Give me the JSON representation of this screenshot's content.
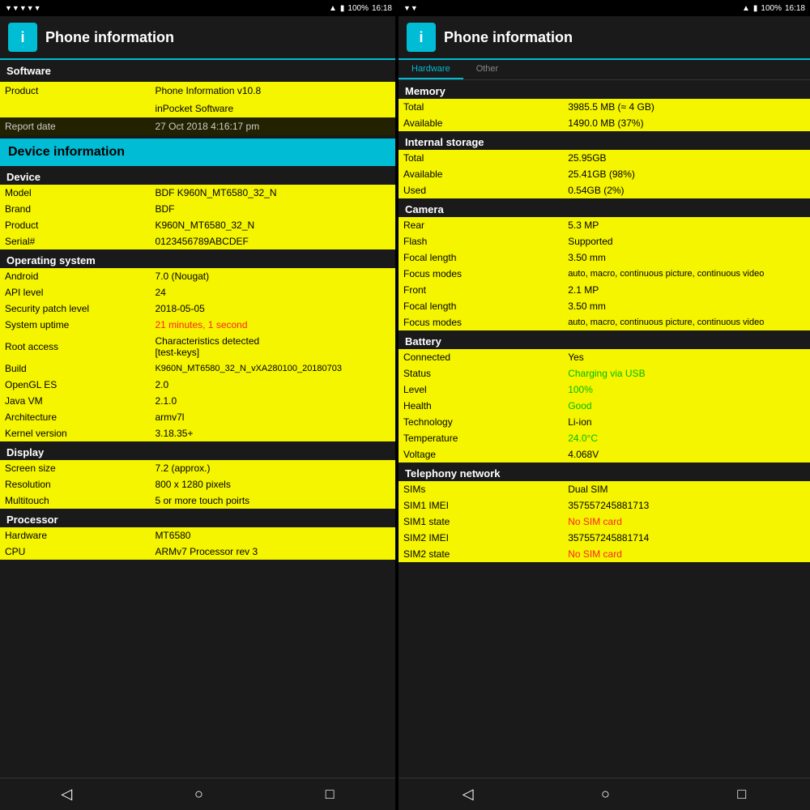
{
  "statusBar": {
    "leftIcons": [
      "▼",
      "▼",
      "▼",
      "▼",
      "▼"
    ],
    "rightText": "100%",
    "time": "16:18",
    "batteryIcon": "▮"
  },
  "leftPanel": {
    "title": "Phone information",
    "tabLeft": "Software",
    "sections": {
      "software": {
        "rows": [
          {
            "label": "Product",
            "value": "Phone Information v10.8",
            "style": "y"
          },
          {
            "label": "",
            "value": "inPocket Software",
            "style": "y"
          },
          {
            "label": "Report date",
            "value": "27 Oct 2018 4:16:17 pm",
            "style": "d"
          }
        ]
      },
      "deviceInfoHeader": "Device information",
      "device": {
        "header": "Device",
        "rows": [
          {
            "label": "Model",
            "value": "BDF K960N_MT6580_32_N",
            "style": "y"
          },
          {
            "label": "Brand",
            "value": "BDF",
            "style": "y"
          },
          {
            "label": "Product",
            "value": "K960N_MT6580_32_N",
            "style": "y"
          },
          {
            "label": "Serial#",
            "value": "0123456789ABCDEF",
            "style": "y"
          }
        ]
      },
      "os": {
        "header": "Operating system",
        "rows": [
          {
            "label": "Android",
            "value": "7.0 (Nougat)",
            "style": "y"
          },
          {
            "label": "API level",
            "value": "24",
            "style": "y"
          },
          {
            "label": "Security patch level",
            "value": "2018-05-05",
            "style": "y"
          },
          {
            "label": "System uptime",
            "value": "21 minutes, 1 second",
            "valueStyle": "red",
            "style": "y"
          },
          {
            "label": "Root access",
            "value": "Characteristics detected\n[test-keys]",
            "style": "y"
          },
          {
            "label": "Build",
            "value": "K960N_MT6580_32_N_vXA280100_20180703",
            "style": "y"
          },
          {
            "label": "OpenGL ES",
            "value": "2.0",
            "style": "y"
          },
          {
            "label": "Java VM",
            "value": "2.1.0",
            "style": "y"
          },
          {
            "label": "Architecture",
            "value": "armv7l",
            "style": "y"
          },
          {
            "label": "Kernel version",
            "value": "3.18.35+",
            "style": "y"
          }
        ]
      },
      "display": {
        "header": "Display",
        "rows": [
          {
            "label": "Screen size",
            "value": "7.2 (approx.)",
            "style": "y"
          },
          {
            "label": "Resolution",
            "value": "800 x 1280 pixels",
            "style": "y"
          },
          {
            "label": "Multitouch",
            "value": "5 or more touch poirts",
            "style": "y"
          }
        ]
      },
      "processor": {
        "header": "Processor",
        "rows": [
          {
            "label": "Hardware",
            "value": "MT6580",
            "style": "y"
          },
          {
            "label": "CPU",
            "value": "ARMv7 Processor rev 3",
            "style": "y"
          }
        ]
      }
    }
  },
  "rightPanel": {
    "title": "Phone information",
    "memory": {
      "header": "Memory",
      "rows": [
        {
          "label": "Total",
          "value": "3985.5 MB (≈ 4 GB)",
          "style": "y"
        },
        {
          "label": "Available",
          "value": "1490.0 MB (37%)",
          "style": "y"
        }
      ]
    },
    "internalStorage": {
      "header": "Internal storage",
      "rows": [
        {
          "label": "Total",
          "value": "25.95GB",
          "style": "y"
        },
        {
          "label": "Available",
          "value": "25.41GB (98%)",
          "style": "y"
        },
        {
          "label": "Used",
          "value": "0.54GB (2%)",
          "style": "y"
        }
      ]
    },
    "camera": {
      "header": "Camera",
      "rear": [
        {
          "label": "Rear",
          "value": "5.3 MP",
          "style": "y"
        },
        {
          "label": "Flash",
          "value": "Supported",
          "style": "y"
        },
        {
          "label": "Focal length",
          "value": "3.50 mm",
          "style": "y"
        },
        {
          "label": "Focus modes",
          "value": "auto, macro, continuous picture, continuous video",
          "style": "y"
        }
      ],
      "front": [
        {
          "label": "Front",
          "value": "2.1 MP",
          "style": "y"
        },
        {
          "label": "Focal length",
          "value": "3.50 mm",
          "style": "y"
        },
        {
          "label": "Focus modes",
          "value": "auto, macro, continuous picture, continuous video",
          "style": "y"
        }
      ]
    },
    "battery": {
      "header": "Battery",
      "rows": [
        {
          "label": "Connected",
          "value": "Yes",
          "style": "y"
        },
        {
          "label": "Status",
          "value": "Charging via USB",
          "valueStyle": "green",
          "style": "y"
        },
        {
          "label": "Level",
          "value": "100%",
          "valueStyle": "green",
          "style": "y"
        },
        {
          "label": "Health",
          "value": "Good",
          "valueStyle": "green",
          "style": "y"
        },
        {
          "label": "Technology",
          "value": "Li-ion",
          "style": "y"
        },
        {
          "label": "Temperature",
          "value": "24.0°C",
          "valueStyle": "green",
          "style": "y"
        },
        {
          "label": "Voltage",
          "value": "4.068V",
          "style": "y"
        }
      ]
    },
    "telephony": {
      "header": "Telephony network",
      "rows": [
        {
          "label": "SIMs",
          "value": "Dual SIM",
          "style": "y"
        },
        {
          "label": "SIM1 IMEI",
          "value": "357557245881713",
          "style": "y"
        },
        {
          "label": "SIM1 state",
          "value": "No SIM card",
          "valueStyle": "red",
          "style": "y"
        },
        {
          "label": "SIM2 IMEI",
          "value": "357557245881714",
          "style": "y"
        },
        {
          "label": "SIM2 state",
          "value": "No SIM card",
          "valueStyle": "red",
          "style": "y"
        }
      ]
    }
  },
  "bottomNav": {
    "back": "◁",
    "home": "○",
    "recents": "□"
  }
}
